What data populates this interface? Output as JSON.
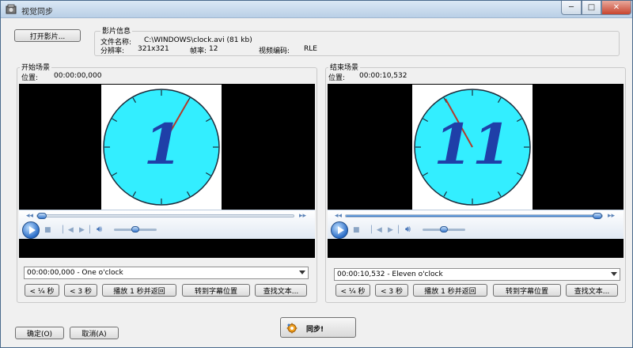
{
  "window": {
    "title": "视觉同步",
    "minimize_glyph": "─",
    "maximize_glyph": "□",
    "close_glyph": "✕"
  },
  "open_video_label": "打开影片...",
  "movie_info": {
    "header": "影片信息",
    "filename_label": "文件名称:",
    "filename_value": "C:\\WINDOWS\\clock.avi (81 kb)",
    "resolution_label": "分辨率:",
    "resolution_value": "321x321",
    "framerate_label": "帧率:",
    "framerate_value": "12",
    "codec_label": "视频编码:",
    "codec_value": "RLE"
  },
  "start_scene": {
    "header": "开始场景",
    "position_label": "位置:",
    "position_value": "00:00:00,000",
    "clock_digit": "1",
    "seek_progress": 0.0,
    "volume_level": 0.5,
    "subtitle_selected": "00:00:00,000 - One o'clock",
    "buttons": {
      "back_quarter": "< ¼ 秒",
      "back_3": "< 3 秒",
      "play_return": "播放 1 秒并返回",
      "goto_sub": "转到字幕位置",
      "find_text": "查找文本..."
    }
  },
  "end_scene": {
    "header": "结束场景",
    "position_label": "位置:",
    "position_value": "00:00:10,532",
    "clock_digit": "11",
    "seek_progress": 0.98,
    "volume_level": 0.5,
    "subtitle_selected": "00:00:10,532 - Eleven o'clock",
    "buttons": {
      "back_quarter": "< ¼ 秒",
      "back_3": "< 3 秒",
      "play_return": "播放 1 秒并返回",
      "goto_sub": "转到字幕位置",
      "find_text": "查找文本..."
    }
  },
  "ok_label": "确定(O)",
  "cancel_label": "取消(A)",
  "sync_label": "同步!",
  "icons": {
    "app": "video-sync-icon",
    "play": "play-icon",
    "stop": "stop-icon",
    "prev": "previous-icon",
    "next": "next-icon",
    "volume": "speaker-icon",
    "rewind": "rewind-icon",
    "fastforward": "fastforward-icon",
    "sync": "gear-sync-icon"
  },
  "colors": {
    "clock_face": "#33eeff",
    "clock_digit": "#1f3fa8",
    "clock_hand": "#b23a2a",
    "video_bg": "#000000"
  }
}
